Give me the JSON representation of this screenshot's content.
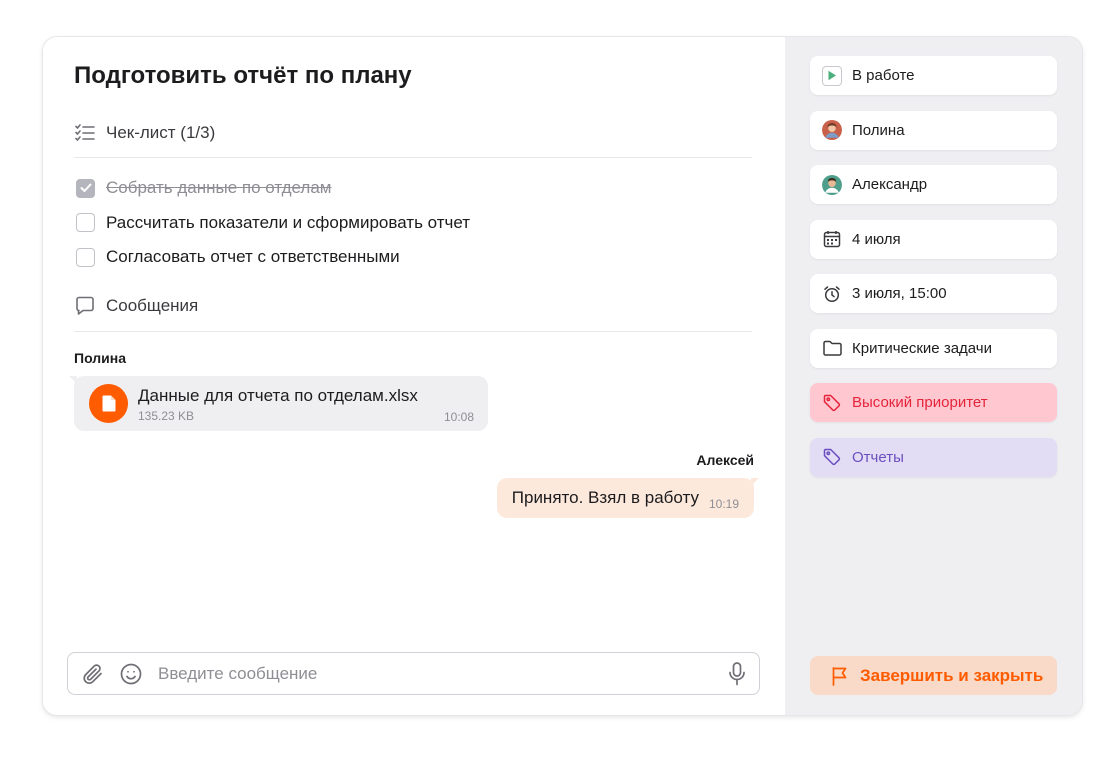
{
  "task": {
    "title": "Подготовить отчёт по плану"
  },
  "checklist": {
    "header": "Чек-лист (1/3)",
    "items": [
      {
        "label": "Собрать данные по отделам",
        "checked": true
      },
      {
        "label": "Рассчитать показатели и сформировать отчет",
        "checked": false
      },
      {
        "label": "Согласовать отчет с ответственными",
        "checked": false
      }
    ]
  },
  "messages": {
    "header": "Сообщения",
    "list": [
      {
        "sender": "Полина",
        "type": "file",
        "file_name": "Данные для отчета по отделам.xlsx",
        "file_size": "135.23 KB",
        "time": "10:08"
      },
      {
        "sender": "Алексей",
        "type": "text",
        "text": "Принято. Взял в работу",
        "time": "10:19"
      }
    ]
  },
  "composer": {
    "placeholder": "Введите сообщение"
  },
  "sidebar": {
    "status": "В работе",
    "author": "Полина",
    "assignee": "Александр",
    "deadline": "4 июля",
    "reminder": "3 июля, 15:00",
    "project": "Критические задачи",
    "tags": [
      {
        "label": "Высокий приоритет",
        "color": "#e5243b",
        "bg": "#ffc7cf"
      },
      {
        "label": "Отчеты",
        "color": "#6b4fc0",
        "bg": "#e3dcf5"
      }
    ],
    "finish_label": "Завершить и закрыть"
  },
  "colors": {
    "accent": "#ff5b00",
    "status_green": "#4caf7d"
  }
}
